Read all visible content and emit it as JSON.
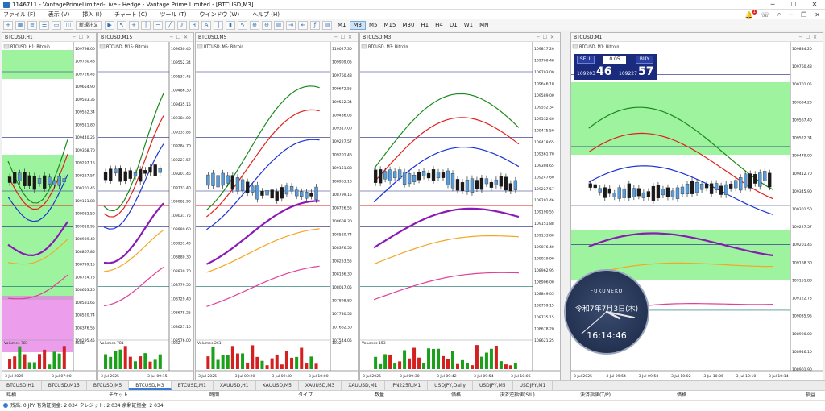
{
  "window": {
    "title": "1146711 - VantagePrimeLimited-Live - Hedge - Vantage Prime Limited - [BTCUSD,M3]"
  },
  "menu": [
    "ファイル (F)",
    "表示 (V)",
    "挿入 (I)",
    "チャート (C)",
    "ツール (T)",
    "ウインドウ (W)",
    "ヘルプ (H)"
  ],
  "toolbar": {
    "new_order": "新規注文",
    "timeframes": [
      "M1",
      "M3",
      "M5",
      "M15",
      "M30",
      "H1",
      "H4",
      "D1",
      "W1",
      "MN"
    ],
    "active_tf": "M3",
    "notify_count": "1"
  },
  "charts": [
    {
      "title": "BTCUSD,H1",
      "label": "BTCUSD, H1: Bitcoin",
      "prices": [
        "109798.00",
        "109760.48",
        "109726.45",
        "109654.90",
        "109583.35",
        "109552.34",
        "109511.80",
        "109440.25",
        "109368.70",
        "109297.15",
        "109227.57",
        "109201.46",
        "109151.88",
        "109082.50",
        "109010.95",
        "108939.40",
        "108867.85",
        "108799.15",
        "108724.75",
        "108653.20",
        "108581.65",
        "108520.74",
        "108376.55",
        "108295.45"
      ],
      "volume": "Volumes 781",
      "vol_max": "4688",
      "dates": [
        "3 Jul 2025",
        "3 Jul 07:00"
      ]
    },
    {
      "title": "BTCUSD,M15",
      "label": "BTCUSD, M15: Bitcoin",
      "prices": [
        "109630.40",
        "109552.34",
        "109537.45",
        "109486.30",
        "109435.15",
        "109384.00",
        "109335.85",
        "109284.70",
        "109227.57",
        "109201.46",
        "109133.40",
        "109082.90",
        "109031.75",
        "108980.60",
        "108931.40",
        "108880.30",
        "108830.70",
        "108779.50",
        "108729.40",
        "108678.25",
        "108627.10",
        "108576.00"
      ],
      "volume": "Volumes 781",
      "vol_max": "1032",
      "dates": [
        "3 Jul 2025",
        "3 Jul 09:15"
      ]
    },
    {
      "title": "BTCUSD,M5",
      "label": "BTCUSD, M5: Bitcoin",
      "prices": [
        "110027.30",
        "109909.05",
        "109760.48",
        "109672.55",
        "109552.34",
        "109436.05",
        "109317.00",
        "109227.57",
        "109201.46",
        "109151.88",
        "108963.10",
        "108799.15",
        "108726.55",
        "108608.30",
        "108520.74",
        "108376.55",
        "108253.55",
        "108136.30",
        "108017.05",
        "107898.80",
        "107780.55",
        "107662.30",
        "107544.05"
      ],
      "volume": "Volumes 261",
      "vol_max": "1032",
      "dates": [
        "3 Jul 2025",
        "3 Jul 09:20",
        "3 Jul 09:40",
        "3 Jul 10:00"
      ]
    },
    {
      "title": "BTCUSD,M3",
      "label": "BTCUSD, M3: Bitcoin",
      "prices": [
        "109817.20",
        "109760.48",
        "109703.00",
        "109646.10",
        "109589.00",
        "109552.34",
        "109532.40",
        "109475.50",
        "109418.65",
        "109361.70",
        "109304.65",
        "109247.60",
        "109227.57",
        "109201.46",
        "109190.55",
        "109151.88",
        "109133.80",
        "109076.40",
        "109019.90",
        "108962.95",
        "108906.00",
        "108849.05",
        "108799.15",
        "108735.15",
        "108678.20",
        "108621.25"
      ],
      "volume": "Volumes 153",
      "dates": [
        "3 Jul 2025",
        "3 Jul 09:30",
        "3 Jul 09:42",
        "3 Jul 09:54",
        "3 Jul 10:06"
      ]
    },
    {
      "title": "BTCUSD,M1",
      "label": "BTCUSD, M1: Bitcoin",
      "prices": [
        "109834.20",
        "109760.48",
        "109701.05",
        "109634.20",
        "109567.40",
        "109522.34",
        "109479.00",
        "109412.70",
        "109345.90",
        "109301.50",
        "109227.57",
        "109201.46",
        "109168.30",
        "109151.88",
        "109122.75",
        "109035.95",
        "108990.00",
        "108946.10",
        "108901.90"
      ],
      "dates": [
        "3 Jul 2025",
        "3 Jul 09:54",
        "3 Jul 09:58",
        "3 Jul 10:02",
        "3 Jul 10:06",
        "3 Jul 10:10",
        "3 Jul 10:14"
      ]
    }
  ],
  "trade": {
    "sell": "SELL",
    "buy": "BUY",
    "lot": "0.05",
    "bid_prefix": "109203",
    "bid_big": "46",
    "ask_prefix": "109227",
    "ask_big": "57"
  },
  "clock": {
    "brand": "FUKUNEKO",
    "date": "令和7年7月3日(木)",
    "time": "16:14:46"
  },
  "tabs": [
    "BTCUSD,H1",
    "BTCUSD,M15",
    "BTCUSD,M5",
    "BTCUSD,M3",
    "BTCUSD,M1",
    "XAUUSD,H1",
    "XAUUSD,M5",
    "XAUUSD,M3",
    "XAUUSD,M1",
    "JPN225ft,M1",
    "USDJPY,Daily",
    "USDJPY,M5",
    "USDJPY,M1"
  ],
  "active_tab": "BTCUSD,M3",
  "trade_columns": [
    "銘柄",
    "チケット",
    "時間",
    "タイプ",
    "数量",
    "価格",
    "決済逆指値(S/L)",
    "決済指値(T/P)",
    "価格",
    "損益"
  ],
  "account": {
    "text": "残高: 0 JPY  有効証拠金: 2 034  クレジット: 2 034  余剰証拠金: 2 034"
  },
  "colors": {
    "accent": "#3a7bd5",
    "bull": "#5b9bd5",
    "bear": "#1a1a1a",
    "ma_red": "#e0201c",
    "ma_green": "#1a8a1a",
    "ma_blue": "#1a32d6",
    "ma_purple": "#8a1ab5",
    "ma_orange": "#f5a623",
    "ma_pink": "#e0409a",
    "zone_green": "#7ef07e",
    "zone_pink": "#e57ee5"
  }
}
